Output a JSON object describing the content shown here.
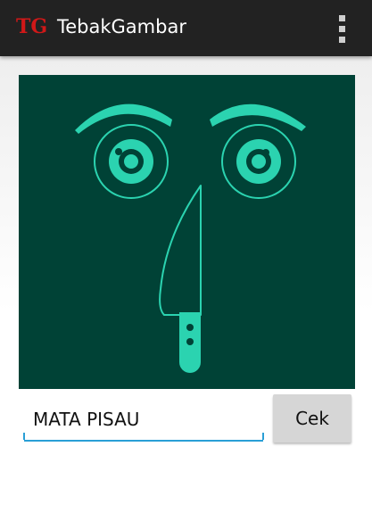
{
  "appbar": {
    "logo": "TG",
    "title": "TebakGambar",
    "menu_icon": "overflow-menu-icon"
  },
  "puzzle": {
    "image_icon": "face-eyes-knife-nose-icon",
    "background_color": "#004236",
    "line_color": "#2bd3b0"
  },
  "answer": {
    "value": "MATA PISAU",
    "underline_color": "#2a9fd6"
  },
  "check_button": {
    "label": "Cek"
  }
}
